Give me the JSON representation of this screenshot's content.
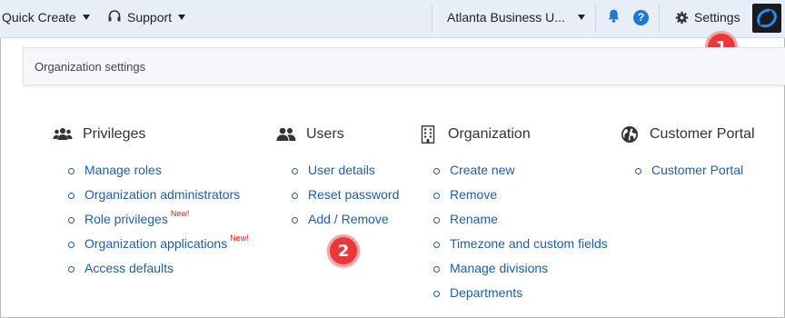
{
  "topbar": {
    "quick_create": "Quick Create",
    "support": "Support",
    "business_unit": "Atlanta Business U...",
    "settings": "Settings",
    "help_glyph": "?",
    "icons": [
      "chevron-down-icon",
      "headset-icon",
      "bell-icon",
      "help-icon",
      "gear-icon",
      "logo-icon"
    ],
    "accent": "#1f78d1"
  },
  "breadcrumb": {
    "text": "Organization settings"
  },
  "callouts": {
    "one": "1",
    "two": "2",
    "color": "#e8383a"
  },
  "columns": [
    {
      "title": "Privileges",
      "icon": "users-group-icon",
      "links": [
        {
          "label": "Manage roles",
          "badge": ""
        },
        {
          "label": "Organization administrators",
          "badge": ""
        },
        {
          "label": "Role privileges",
          "badge": "New!"
        },
        {
          "label": "Organization applications",
          "badge": "New!"
        },
        {
          "label": "Access defaults",
          "badge": ""
        }
      ]
    },
    {
      "title": "Users",
      "icon": "users-icon",
      "links": [
        {
          "label": "User details"
        },
        {
          "label": "Reset password"
        },
        {
          "label": "Add / Remove"
        }
      ]
    },
    {
      "title": "Organization",
      "icon": "building-icon",
      "links": [
        {
          "label": "Create new"
        },
        {
          "label": "Remove"
        },
        {
          "label": "Rename"
        },
        {
          "label": "Timezone and custom fields"
        },
        {
          "label": "Manage divisions"
        },
        {
          "label": "Departments"
        }
      ]
    },
    {
      "title": "Customer Portal",
      "icon": "globe-icon",
      "links": [
        {
          "label": "Customer Portal"
        }
      ]
    }
  ],
  "colors": {
    "link": "#1f5fa8",
    "new_badge": "#e02020",
    "topbar_bg": "#e8eef7"
  }
}
